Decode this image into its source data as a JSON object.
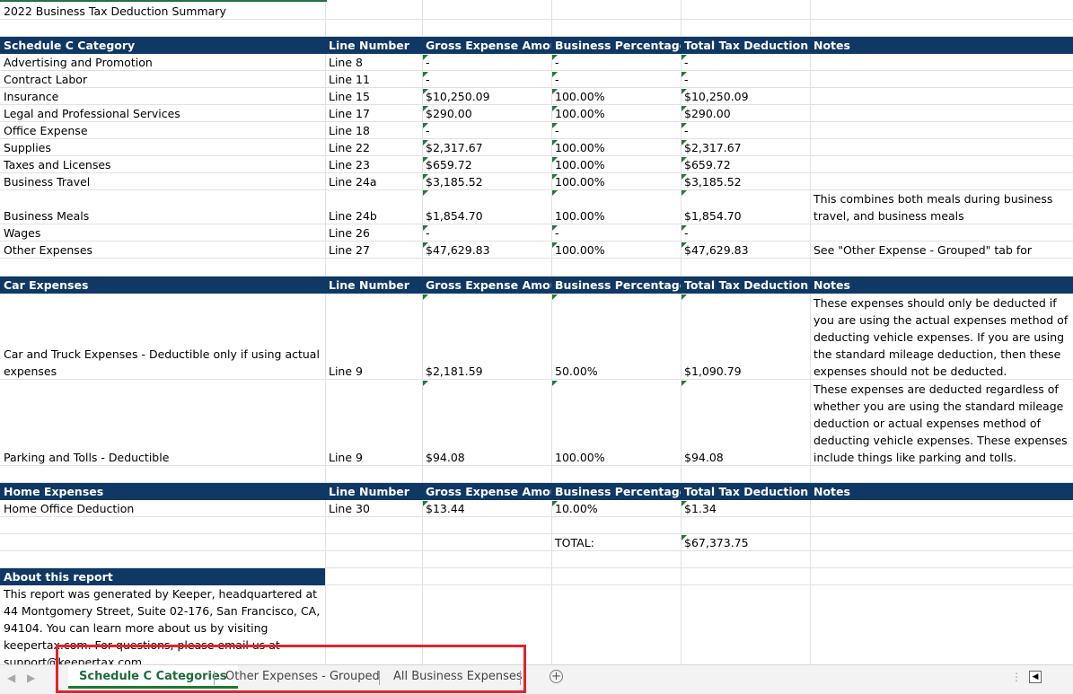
{
  "title": "2022 Business Tax Deduction Summary",
  "schedule_c": {
    "headers": [
      "Schedule C Category",
      "Line Number",
      "Gross Expense Amount",
      "Business Percentage",
      "Total Tax Deduction",
      "Notes"
    ],
    "rows": [
      {
        "category": "Advertising and Promotion",
        "line": "Line 8",
        "gross": "-",
        "pct": "-",
        "total": "-",
        "notes": ""
      },
      {
        "category": "Contract Labor",
        "line": "Line 11",
        "gross": "-",
        "pct": "-",
        "total": "-",
        "notes": ""
      },
      {
        "category": "Insurance",
        "line": "Line 15",
        "gross": "$10,250.09",
        "pct": "100.00%",
        "total": "$10,250.09",
        "notes": ""
      },
      {
        "category": "Legal and Professional Services",
        "line": "Line 17",
        "gross": "$290.00",
        "pct": "100.00%",
        "total": "$290.00",
        "notes": ""
      },
      {
        "category": "Office Expense",
        "line": "Line 18",
        "gross": "-",
        "pct": "-",
        "total": "-",
        "notes": ""
      },
      {
        "category": "Supplies",
        "line": "Line 22",
        "gross": "$2,317.67",
        "pct": "100.00%",
        "total": "$2,317.67",
        "notes": ""
      },
      {
        "category": "Taxes and Licenses",
        "line": "Line 23",
        "gross": "$659.72",
        "pct": "100.00%",
        "total": "$659.72",
        "notes": ""
      },
      {
        "category": "Business Travel",
        "line": "Line 24a",
        "gross": "$3,185.52",
        "pct": "100.00%",
        "total": "$3,185.52",
        "notes": ""
      },
      {
        "category": "Business Meals",
        "line": "Line 24b",
        "gross": "$1,854.70",
        "pct": "100.00%",
        "total": "$1,854.70",
        "notes": "This combines both meals during business travel, and business meals"
      },
      {
        "category": "Wages",
        "line": "Line 26",
        "gross": "-",
        "pct": "-",
        "total": "-",
        "notes": ""
      },
      {
        "category": "Other Expenses",
        "line": "Line 27",
        "gross": "$47,629.83",
        "pct": "100.00%",
        "total": "$47,629.83",
        "notes": "See \"Other Expense - Grouped\" tab for details"
      }
    ]
  },
  "car": {
    "headers": [
      "Car Expenses",
      "Line Number",
      "Gross Expense Amount",
      "Business Percentage",
      "Total Tax Deduction",
      "Notes"
    ],
    "rows": [
      {
        "category": "Car and Truck Expenses - Deductible only if using actual expenses",
        "line": "Line 9",
        "gross": "$2,181.59",
        "pct": "50.00%",
        "total": "$1,090.79",
        "notes": "These expenses should only be deducted if you are using the actual expenses method of deducting vehicle expenses. If you are using the standard mileage deduction, then these expenses should not be deducted."
      },
      {
        "category": "Parking and Tolls - Deductible",
        "line": "Line 9",
        "gross": "$94.08",
        "pct": "100.00%",
        "total": "$94.08",
        "notes": "These expenses are deducted regardless of whether you are using the standard mileage deduction or actual expenses method of deducting vehicle expenses. These expenses include things like parking and tolls."
      }
    ]
  },
  "home": {
    "headers": [
      "Home Expenses",
      "Line Number",
      "Gross Expense Amount",
      "Business Percentage",
      "Total Tax Deduction",
      "Notes"
    ],
    "rows": [
      {
        "category": "Home Office Deduction",
        "line": "Line 30",
        "gross": "$13.44",
        "pct": "10.00%",
        "total": "$1.34",
        "notes": ""
      }
    ]
  },
  "total": {
    "label": "TOTAL:",
    "value": "$67,373.75"
  },
  "about": {
    "heading": "About this report",
    "text": "This report was generated by Keeper, headquartered at 44 Montgomery Street, Suite 02-176, San Francisco, CA, 94104. You can learn more about us by visiting keepertax.com. For questions, please email us at support@keepertax.com"
  },
  "tabs": [
    {
      "label": "Schedule C Categories",
      "active": true
    },
    {
      "label": "Other Expenses - Grouped",
      "active": false
    },
    {
      "label": "All Business Expenses",
      "active": false
    }
  ],
  "icons": {
    "add_sheet": "plus-circle-icon",
    "nav_prev": "triangle-left-icon",
    "nav_next": "triangle-right-icon"
  },
  "colors": {
    "header_bg": "#0f3864",
    "header_text": "#ffffff",
    "active_tab": "#1e7b34",
    "highlight_box": "#e0242d"
  }
}
